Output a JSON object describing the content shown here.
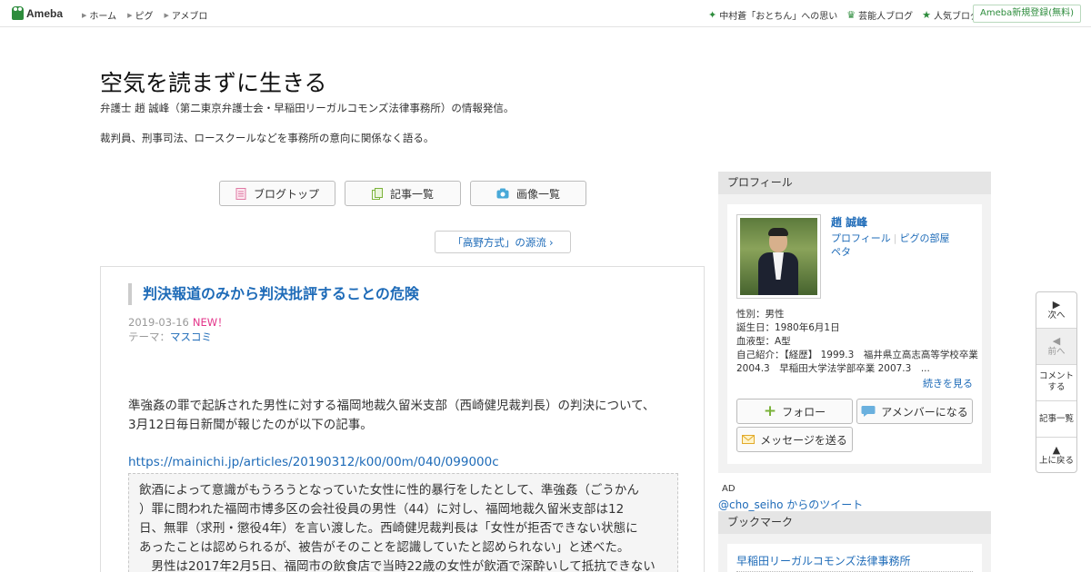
{
  "topbar": {
    "logo_text": "Ameba",
    "nav": [
      "ホーム",
      "ピグ",
      "アメブロ"
    ],
    "right_links": [
      {
        "icon": "sparkle-icon",
        "label": "中村蒼「おとちん」への思い"
      },
      {
        "icon": "crown-icon",
        "label": "芸能人ブログ"
      },
      {
        "icon": "star-icon",
        "label": "人気ブログ"
      }
    ],
    "register_label": "Ameba新規登録(無料)"
  },
  "header": {
    "title": "空気を読まずに生きる",
    "desc1": "弁護士 趙 誠峰（第二東京弁護士会・早稲田リーガルコモンズ法律事務所）の情報発信。",
    "desc2": "裁判員、刑事司法、ロースクールなどを事務所の意向に関係なく語る。"
  },
  "blognav": {
    "top_label": "ブログトップ",
    "list_label": "記事一覧",
    "image_label": "画像一覧"
  },
  "prev_article": "「高野方式」の源流",
  "article": {
    "title": "判決報道のみから判決批評することの危険",
    "date": "2019-03-16",
    "new_badge": "NEW！",
    "theme_prefix": "テーマ：",
    "theme": "マスコミ",
    "body_line1": "準強姦の罪で起訴された男性に対する福岡地裁久留米支部（西崎健児裁判長）の判決について、",
    "body_line2": "3月12日毎日新聞が報じたのが以下の記事。",
    "link": "https://mainichi.jp/articles/20190312/k00/00m/040/099000c",
    "quote": [
      "飲酒によって意識がもうろうとなっていた女性に性的暴行をしたとして、準強姦（ごうかん",
      "）罪に問われた福岡市博多区の会社役員の男性（44）に対し、福岡地裁久留米支部は12",
      "日、無罪（求刑・懲役4年）を言い渡した。西崎健児裁判長は「女性が拒否できない状態に",
      "あったことは認められるが、被告がそのことを認識していたと認められない」と述べた。",
      "　男性は2017年2月5日、福岡市の飲食店で当時22歳の女性が飲酒で深酔いして抵抗できない"
    ]
  },
  "sidebar": {
    "profile_heading": "プロフィール",
    "name": "趙 誠峰",
    "link_profile": "プロフィール",
    "link_room": "ピグの部屋",
    "link_peta": "ペタ",
    "gender": "性別：男性",
    "birthday": "誕生日：1980年6月1日",
    "blood": "血液型：A型",
    "intro": "自己紹介：【経歴】 1999.3　福井県立高志高等学校卒業 2004.3　早稲田大学法学部卒業 2007.3　...",
    "read_more": "続きを見る",
    "follow_label": "フォロー",
    "amember_label": "アメンバーになる",
    "message_label": "メッセージを送る",
    "ad_label": "AD",
    "tweet_link": "@cho_seiho からのツイート",
    "bookmark_heading": "ブックマーク",
    "bookmark_link": "早稲田リーガルコモンズ法律事務所"
  },
  "floatnav": {
    "next": "次へ",
    "prev": "前へ",
    "comment": "コメント\nする",
    "list": "記事一覧",
    "top": "上に戻る"
  },
  "colors": {
    "brand_green": "#2d8c3c",
    "link_blue": "#1e6bb8",
    "new_pink": "#e3358a"
  }
}
